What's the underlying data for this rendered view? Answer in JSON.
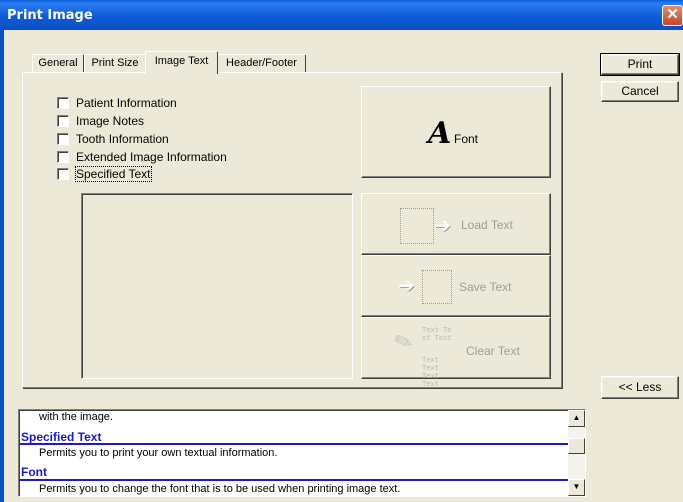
{
  "window": {
    "title": "Print Image",
    "close_glyph": "✕"
  },
  "buttons": {
    "print": "Print",
    "cancel": "Cancel",
    "less": "<< Less"
  },
  "tabs": [
    {
      "label": "General"
    },
    {
      "label": "Print Size"
    },
    {
      "label": "Image Text"
    },
    {
      "label": "Header/Footer"
    }
  ],
  "checkboxes": [
    {
      "label": "Patient Information",
      "checked": false
    },
    {
      "label": "Image Notes",
      "checked": false
    },
    {
      "label": "Tooth Information",
      "checked": false
    },
    {
      "label": "Extended Image Information",
      "checked": false
    },
    {
      "label": "Specified Text",
      "checked": false
    }
  ],
  "actions": {
    "font": {
      "label": "Font",
      "glyph": "A"
    },
    "load": {
      "label": "Load Text"
    },
    "save": {
      "label": "Save Text"
    },
    "clear": {
      "label": "Clear Text",
      "icon_text": [
        "Text Te",
        "xt Text",
        "Text Text",
        "Text Text"
      ]
    }
  },
  "help": {
    "lines": [
      {
        "type": "text",
        "text": "with the image."
      },
      {
        "type": "heading",
        "text": "Specified Text"
      },
      {
        "type": "text",
        "text": "Permits you to print your own textual information."
      },
      {
        "type": "heading",
        "text": "Font"
      },
      {
        "type": "text",
        "text": "Permits you to change the font that is to be used when printing image text."
      }
    ]
  }
}
